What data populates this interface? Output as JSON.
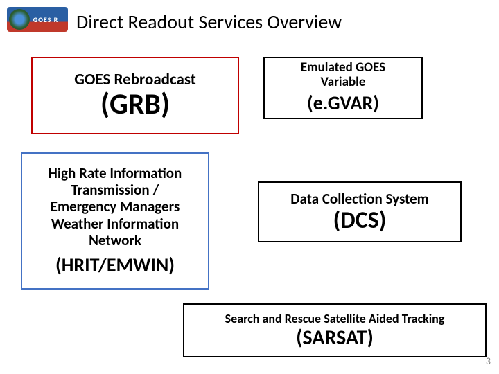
{
  "logo_text": "GOES R",
  "title": "Direct Readout Services Overview",
  "boxes": {
    "grb": {
      "label": "GOES Rebroadcast",
      "abbr": "(GRB)"
    },
    "egvar": {
      "label": "Emulated GOES\nVariable",
      "abbr": "(e.GVAR)"
    },
    "hrit": {
      "label": "High Rate Information\nTransmission /\nEmergency Managers\nWeather Information\nNetwork",
      "abbr": "(HRIT/EMWIN)"
    },
    "dcs": {
      "label": "Data Collection System",
      "abbr": "(DCS)"
    },
    "sarsat": {
      "label": "Search and Rescue Satellite Aided Tracking",
      "abbr": "(SARSAT)"
    }
  },
  "page_number": "3"
}
